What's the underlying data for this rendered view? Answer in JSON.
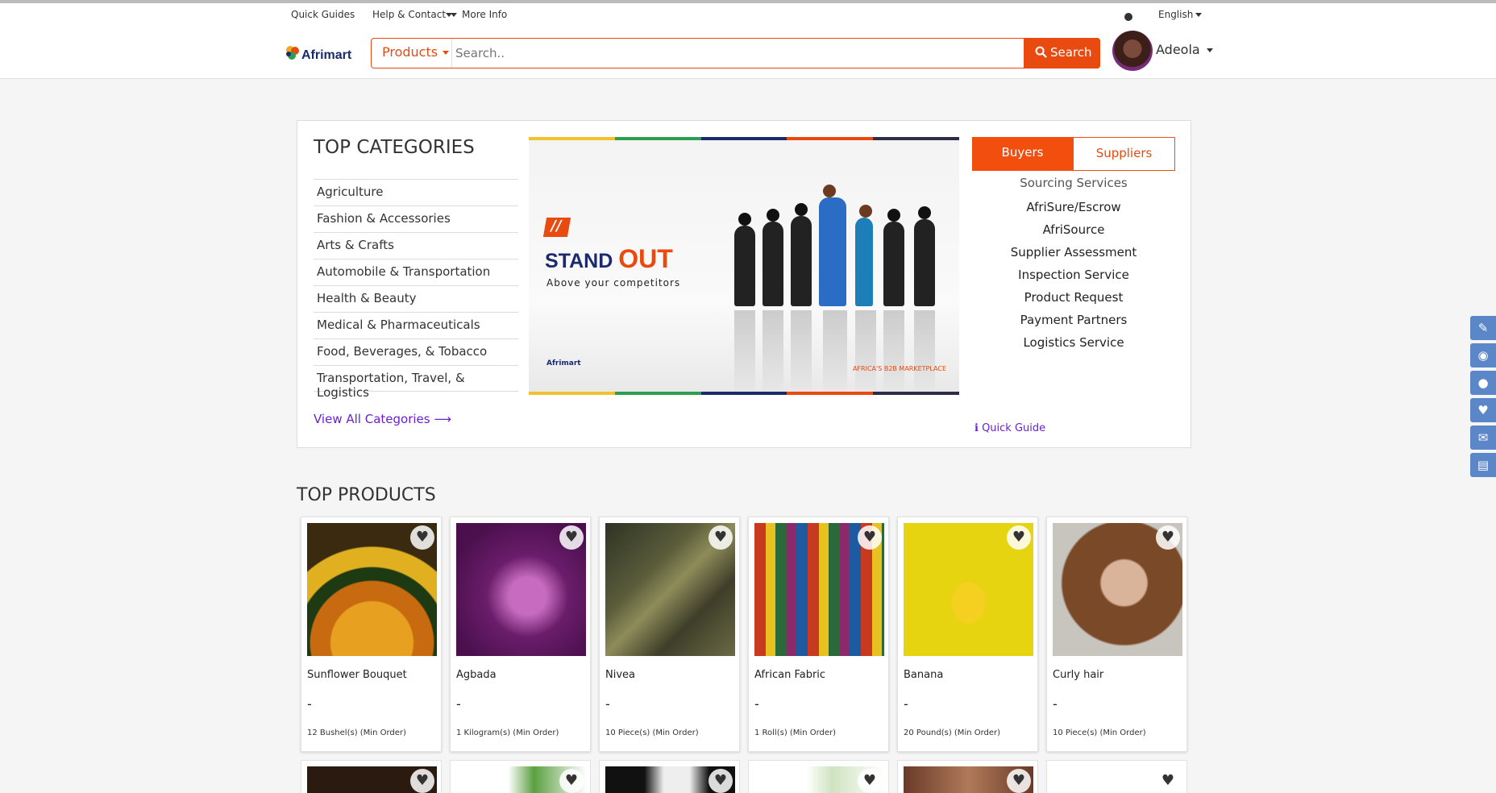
{
  "utilbar": {
    "quick_guides": "Quick Guides",
    "help_contact": "Help & Contact",
    "more_info": "More Info",
    "language": "English"
  },
  "header": {
    "logo_text": "Afrimart",
    "products_label": "Products",
    "search_placeholder": "Search..",
    "search_button": "Search",
    "username": "Adeola"
  },
  "categories": {
    "title": "TOP CATEGORIES",
    "items": [
      "Agriculture",
      "Fashion & Accessories",
      "Arts & Crafts",
      "Automobile & Transportation",
      "Health & Beauty",
      "Medical & Pharmaceuticals",
      "Food, Beverages, & Tobacco",
      "Transportation, Travel, & Logistics"
    ],
    "view_all": "View All Categories ⟶"
  },
  "banner": {
    "stand": "STAND ",
    "out": "OUT",
    "tagline": "Above your competitors",
    "logo_small": "Afrimart",
    "marketplace": "AFRICA'S B2B MARKETPLACE"
  },
  "services": {
    "tabs": [
      "Buyers",
      "Suppliers"
    ],
    "heading": "Sourcing Services",
    "items": [
      "AfriSure/Escrow",
      "AfriSource",
      "Supplier Assessment",
      "Inspection Service",
      "Product Request",
      "Payment Partners",
      "Logistics Service"
    ],
    "quick_guide": "ℹ Quick Guide"
  },
  "top_products": {
    "title": "TOP PRODUCTS",
    "items": [
      {
        "name": "Sunflower Bouquet",
        "price": "-",
        "min": "12 Bushel(s) (Min Order)"
      },
      {
        "name": "Agbada",
        "price": "-",
        "min": "1 Kilogram(s) (Min Order)"
      },
      {
        "name": "Nivea",
        "price": "-",
        "min": "10 Piece(s) (Min Order)"
      },
      {
        "name": "African Fabric",
        "price": "-",
        "min": "1 Roll(s) (Min Order)"
      },
      {
        "name": "Banana",
        "price": "-",
        "min": "20 Pound(s) (Min Order)"
      },
      {
        "name": "Curly hair",
        "price": "-",
        "min": "10 Piece(s) (Min Order)"
      }
    ]
  },
  "colors": {
    "accent": "#e84a0f",
    "link": "#6a1fd1",
    "side_tool": "#5b86c7"
  },
  "side_tools": [
    "edit-icon",
    "user-circle-icon",
    "user-icon",
    "heart-icon",
    "envelope-icon",
    "file-icon"
  ]
}
